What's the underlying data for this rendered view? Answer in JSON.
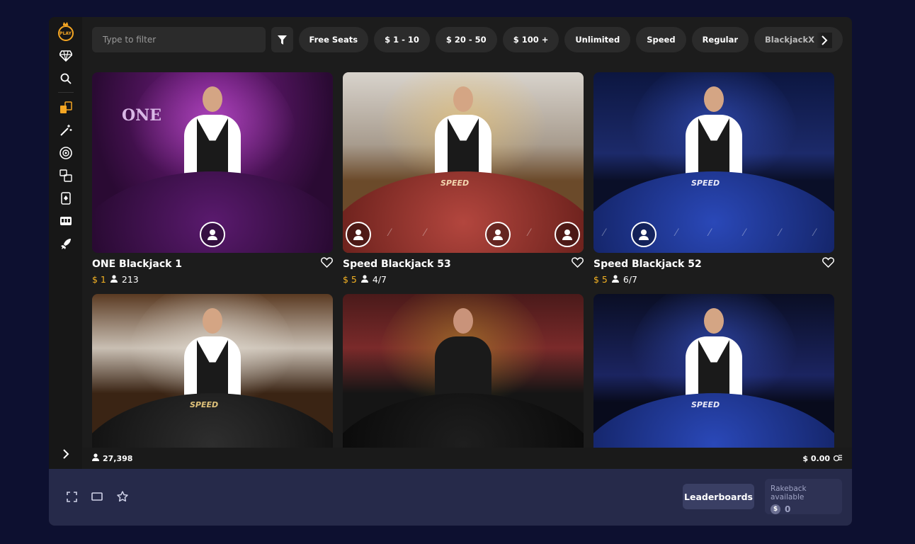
{
  "sidebar": {
    "logo": "PLAY",
    "icons": [
      "gem-icon",
      "search-icon",
      "baccarat-icon",
      "magic-wand-icon",
      "roulette-icon",
      "table-games-icon",
      "blackjack-card-icon",
      "slot-machine-icon",
      "rocket-icon"
    ],
    "expand_icon": "chevron-right-icon"
  },
  "filter": {
    "placeholder": "Type to filter",
    "chips": [
      "Free Seats",
      "$ 1 - 10",
      "$ 20 - 50",
      "$ 100 +",
      "Unlimited",
      "Speed",
      "Regular",
      "BlackjackX"
    ]
  },
  "tables": [
    {
      "title": "ONE Blackjack 1",
      "bet": "$ 1",
      "players": "213",
      "theme": "purple"
    },
    {
      "title": "Speed Blackjack 53",
      "bet": "$ 5",
      "players": "4/7",
      "theme": "red"
    },
    {
      "title": "Speed Blackjack 52",
      "bet": "$ 5",
      "players": "6/7",
      "theme": "blue"
    },
    {
      "theme": "black"
    },
    {
      "theme": "dark"
    },
    {
      "theme": "blue"
    }
  ],
  "status": {
    "online": "27,398",
    "balance": "$ 0.00"
  },
  "footer": {
    "leaderboards": "Leaderboards",
    "rakeback_label": "Rakeback available",
    "rakeback_value": "0"
  }
}
